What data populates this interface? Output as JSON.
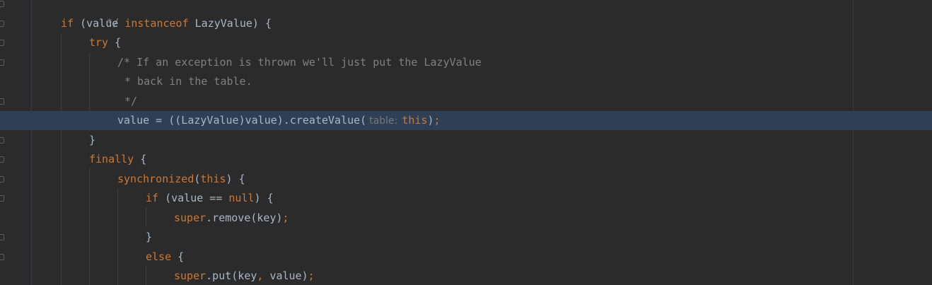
{
  "theme": {
    "background": "#2b2b2b",
    "current_line": "#2e3f56",
    "keyword": "#cc7832",
    "comment": "#808080",
    "plain": "#a9b7c6",
    "inlay_hint": "#787878"
  },
  "gutter": {
    "icon": "fold-marker-icon"
  },
  "code": {
    "l0": [
      "*/"
    ],
    "l1": [
      "if",
      " (value ",
      "instanceof",
      " LazyValue) {"
    ],
    "l2": [
      "try",
      " {"
    ],
    "l3": [
      "/* If an exception is thrown we'll just put the LazyValue"
    ],
    "l4": [
      "* back in the table."
    ],
    "l5": [
      "*/"
    ],
    "l6": [
      "value = ((LazyValue)value).createValue(",
      "table:",
      "this",
      ")",
      ";"
    ],
    "l7": [
      "}"
    ],
    "l8": [
      "finally",
      " {"
    ],
    "l9": [
      "synchronized",
      "(",
      "this",
      ") {"
    ],
    "l10": [
      "if",
      " (value == ",
      "null",
      ") {"
    ],
    "l11": [
      "super",
      ".remove(key)",
      ";"
    ],
    "l12": [
      "}"
    ],
    "l13": [
      "else",
      " {"
    ],
    "l14": [
      "super",
      ".put(key",
      ",",
      " value)",
      ";"
    ]
  }
}
